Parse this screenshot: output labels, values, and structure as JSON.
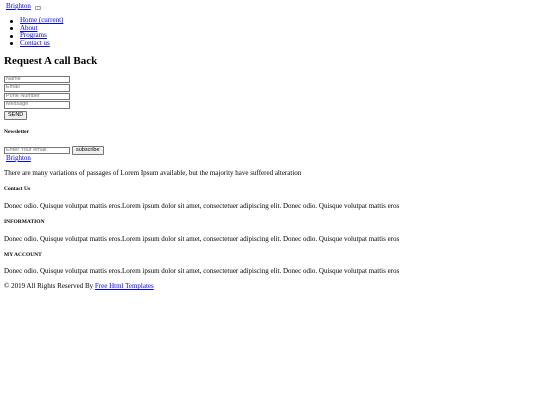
{
  "header": {
    "brand": "Brighton"
  },
  "nav": {
    "items": [
      {
        "label": "Home (current)"
      },
      {
        "label": "About"
      },
      {
        "label": "Programs"
      },
      {
        "label": "Contact us"
      }
    ]
  },
  "callback": {
    "title": "Request A call Back",
    "name_placeholder": "Name",
    "email_placeholder": "Email",
    "phone_placeholder": "Pone Number",
    "message_placeholder": "Message",
    "send_label": "SEND"
  },
  "newsletter": {
    "title": "Newsletter",
    "email_placeholder": "Enter Your email",
    "subscribe_label": "subscribe"
  },
  "footer": {
    "brand": "Brighton",
    "about_text": "There are many variations of passages of Lorem Ipsum available, but the majority have suffered alteration",
    "contact_title": "Contact Us",
    "contact_text": "Donec odio. Quisque volutpat mattis eros.Lorem ipsum dolor sit amet, consectetuer adipiscing elit. Donec odio. Quisque volutpat mattis eros",
    "information_title": "INFORMATION",
    "information_text": "Donec odio. Quisque volutpat mattis eros.Lorem ipsum dolor sit amet, consectetuer adipiscing elit. Donec odio. Quisque volutpat mattis eros",
    "account_title": "MY ACCOUNT",
    "account_text": "Donec odio. Quisque volutpat mattis eros.Lorem ipsum dolor sit amet, consectetuer adipiscing elit. Donec odio. Quisque volutpat mattis eros",
    "copyright_prefix": "© 2019 All Rights Reserved By",
    "copyright_link": "Free Html Templates"
  }
}
